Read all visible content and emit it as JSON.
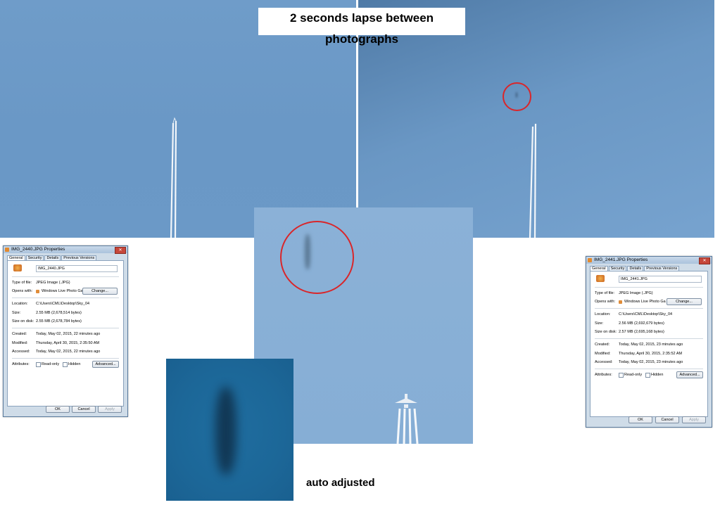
{
  "heading": "2 seconds lapse between photographs",
  "caption": "auto adjusted",
  "dialogs": [
    {
      "title": "IMG_2440.JPG Properties",
      "tabs": [
        "General",
        "Security",
        "Details",
        "Previous Versions"
      ],
      "filename": "IMG_2440.JPG",
      "type_label": "Type of file:",
      "type_value": "JPEG Image (.JPG)",
      "opens_label": "Opens with:",
      "opens_value": "Windows Live Photo Ga",
      "change_label": "Change...",
      "location_label": "Location:",
      "location_value": "C:\\Users\\CML\\Desktop\\Sky_04",
      "size_label": "Size:",
      "size_value": "2.55 MB (2,678,514 bytes)",
      "disk_label": "Size on disk:",
      "disk_value": "2.55 MB (2,678,784 bytes)",
      "created_label": "Created:",
      "created_value": "Today, May 02, 2015, 22 minutes ago",
      "modified_label": "Modified:",
      "modified_value": "Thursday, April 30, 2015, 2:35:50 AM",
      "accessed_label": "Accessed:",
      "accessed_value": "Today, May 02, 2015, 22 minutes ago",
      "attr_label": "Attributes:",
      "readonly_label": "Read-only",
      "hidden_label": "Hidden",
      "advanced_label": "Advanced...",
      "ok_label": "OK",
      "cancel_label": "Cancel",
      "apply_label": "Apply"
    },
    {
      "title": "IMG_2441.JPG Properties",
      "tabs": [
        "General",
        "Security",
        "Details",
        "Previous Versions"
      ],
      "filename": "IMG_2441.JPG",
      "type_label": "Type of file:",
      "type_value": "JPEG Image (.JPG)",
      "opens_label": "Opens with:",
      "opens_value": "Windows Live Photo Ga",
      "change_label": "Change...",
      "location_label": "Location:",
      "location_value": "C:\\Users\\CML\\Desktop\\Sky_04",
      "size_label": "Size:",
      "size_value": "2.56 MB (2,692,679 bytes)",
      "disk_label": "Size on disk:",
      "disk_value": "2.57 MB (2,695,168 bytes)",
      "created_label": "Created:",
      "created_value": "Today, May 02, 2015, 23 minutes ago",
      "modified_label": "Modified:",
      "modified_value": "Thursday, April 30, 2015, 2:35:52 AM",
      "accessed_label": "Accessed:",
      "accessed_value": "Today, May 02, 2015, 23 minutes ago",
      "attr_label": "Attributes:",
      "readonly_label": "Read-only",
      "hidden_label": "Hidden",
      "advanced_label": "Advanced...",
      "ok_label": "OK",
      "cancel_label": "Cancel",
      "apply_label": "Apply"
    }
  ],
  "colors": {
    "sky": "#6b99c7",
    "highlight_circle": "#d9262a",
    "zoom_bg": "#1c6798"
  }
}
